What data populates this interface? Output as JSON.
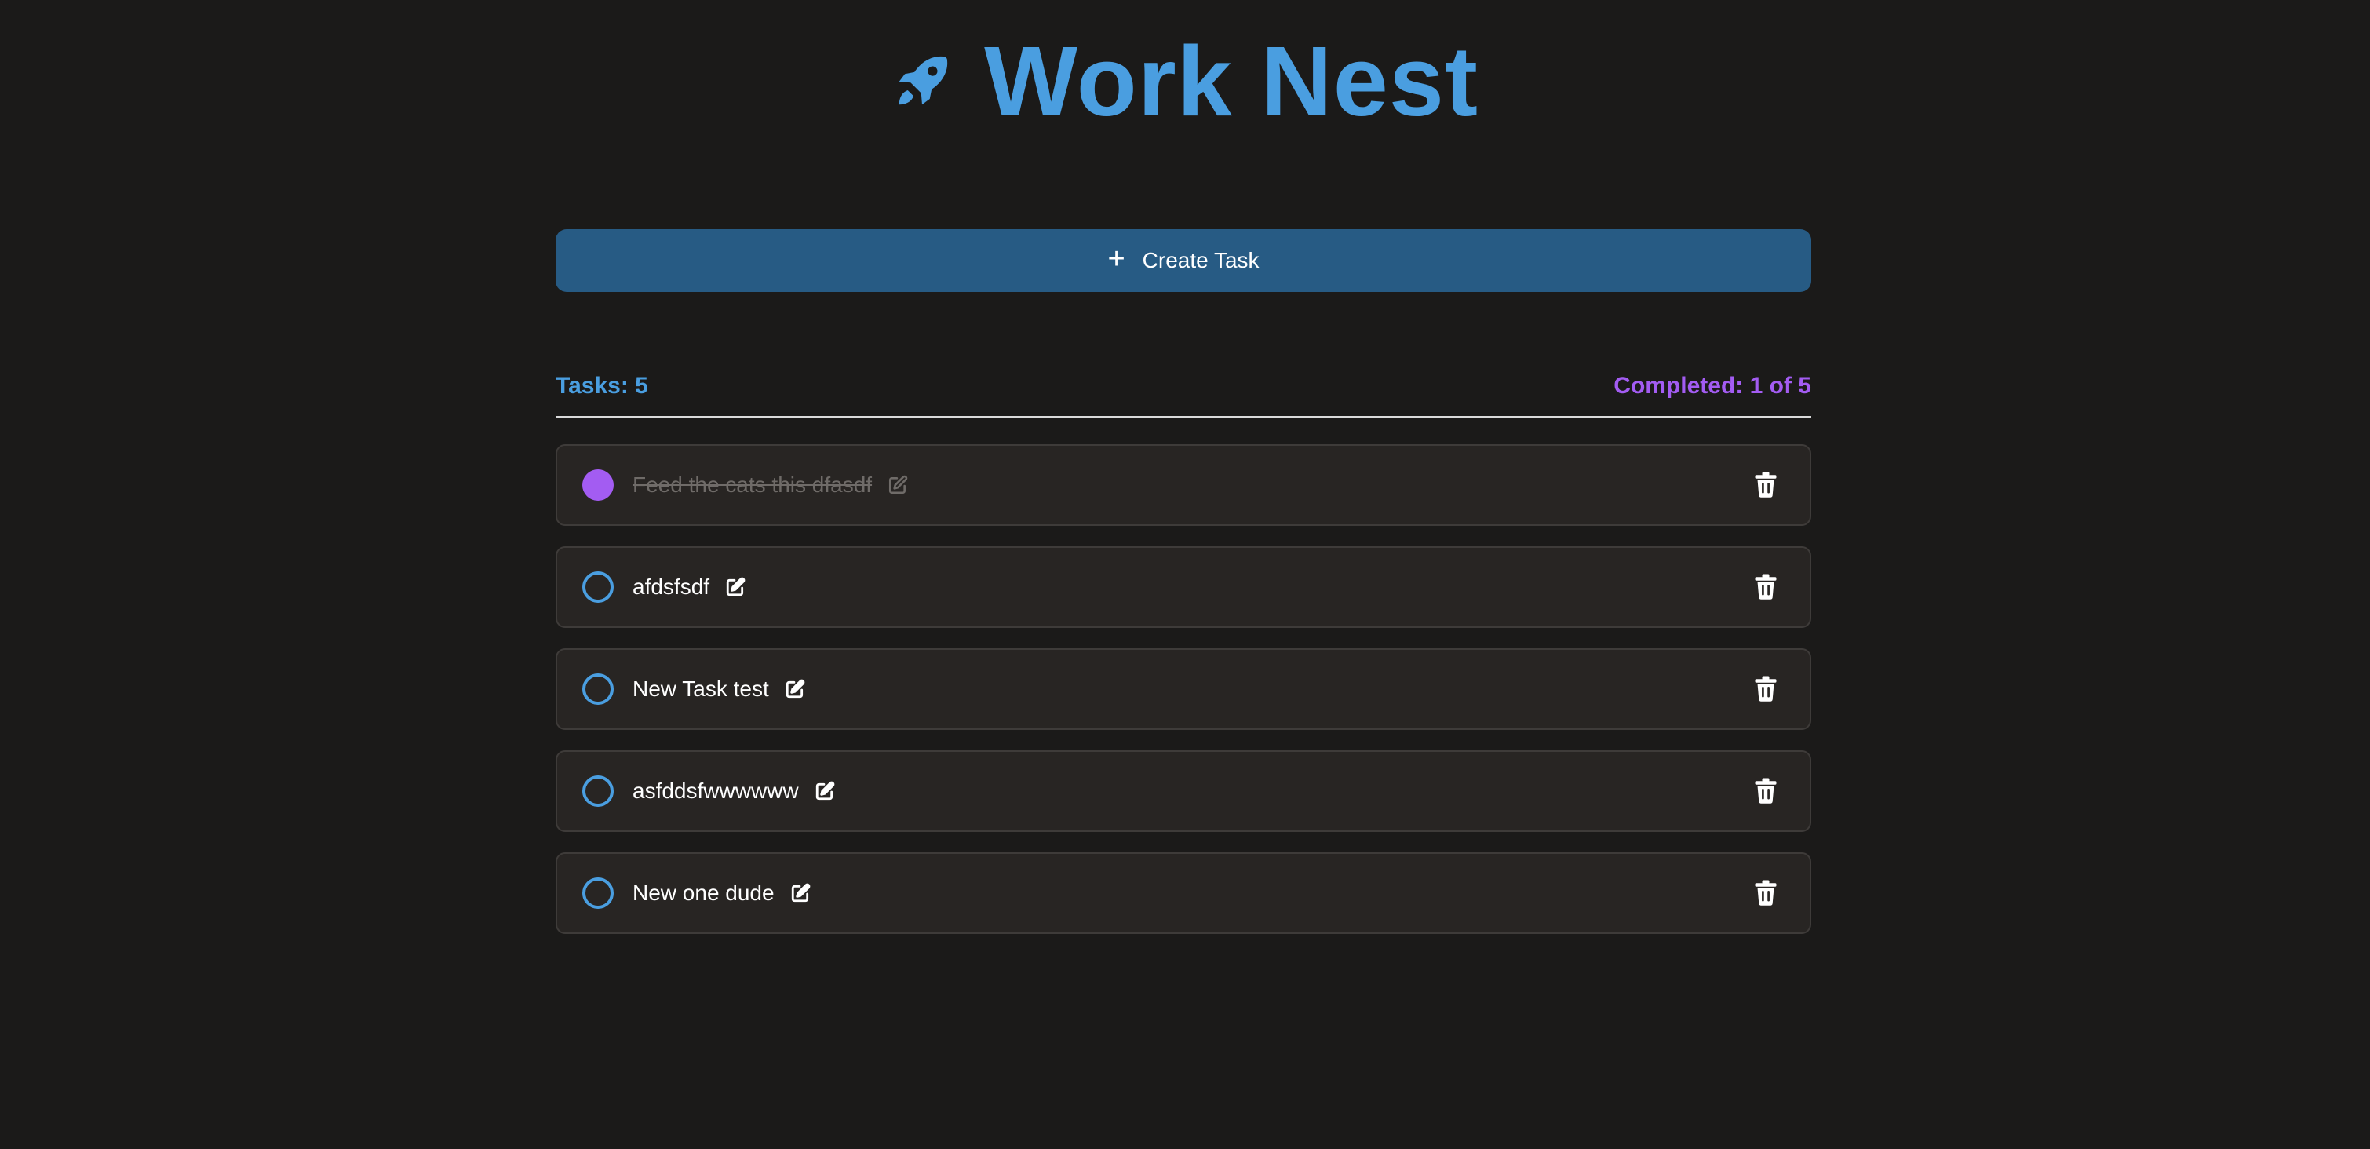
{
  "app": {
    "title": "Work Nest",
    "logo_icon": "rocket-icon"
  },
  "create_button": {
    "label": "Create Task",
    "icon": "plus-icon",
    "plus_glyph": "+"
  },
  "stats": {
    "tasks_label": "Tasks: 5",
    "completed_label": "Completed: 1 of 5"
  },
  "tasks": [
    {
      "label": "Feed the cats this dfasdf",
      "completed": true
    },
    {
      "label": "afdsfsdf",
      "completed": false
    },
    {
      "label": "New Task test",
      "completed": false
    },
    {
      "label": "asfddsfwwwwww",
      "completed": false
    },
    {
      "label": "New one dude",
      "completed": false
    }
  ],
  "colors": {
    "background": "#1b1a19",
    "accent_blue": "#4a9ee0",
    "accent_purple": "#a35cf2",
    "button_blue": "#275b84",
    "task_background": "#282523",
    "completed_text": "#6f6b68"
  },
  "icons": {
    "edit": "edit-icon",
    "delete": "trash-icon",
    "checkbox_open": "circle-icon",
    "checkbox_done": "filled-circle-icon"
  }
}
